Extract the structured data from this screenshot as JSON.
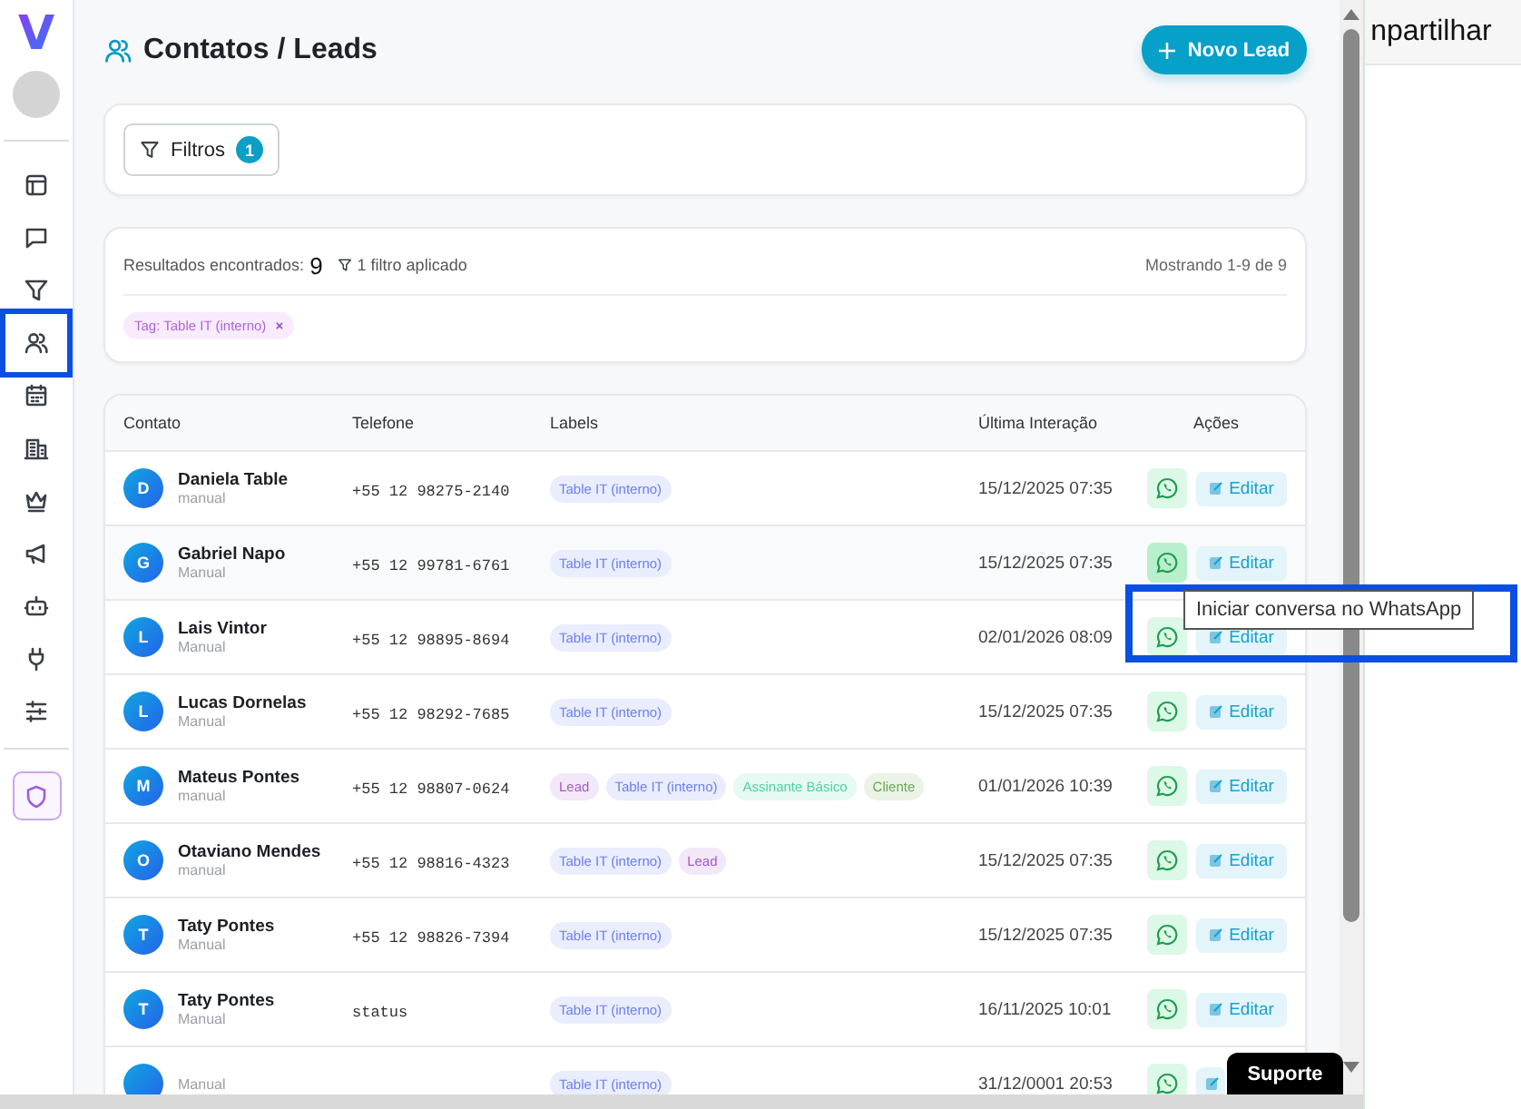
{
  "sidebar": {
    "logo": "V",
    "items": [
      {
        "kind": "layout",
        "selected": false
      },
      {
        "kind": "chat",
        "selected": false
      },
      {
        "kind": "filter",
        "selected": false
      },
      {
        "kind": "users",
        "selected": true
      },
      {
        "kind": "calendar",
        "selected": false
      },
      {
        "kind": "building",
        "selected": false
      },
      {
        "kind": "crown",
        "selected": false
      },
      {
        "kind": "megaphone",
        "selected": false
      },
      {
        "kind": "bot",
        "selected": false
      },
      {
        "kind": "plug",
        "selected": false
      },
      {
        "kind": "sliders",
        "selected": false
      }
    ],
    "bottom_items": [
      {
        "kind": "shield",
        "selected": false
      }
    ]
  },
  "page": {
    "title": "Contatos / Leads",
    "new_button": "Novo Lead"
  },
  "filters": {
    "button": "Filtros",
    "count": "1"
  },
  "results": {
    "label": "Resultados encontrados:",
    "count": "9",
    "applied": "1 filtro aplicado",
    "showing": "Mostrando 1-9 de 9",
    "tags": [
      {
        "text": "Tag: Table IT (interno)",
        "remove": "×"
      }
    ]
  },
  "table": {
    "columns": [
      "Contato",
      "Telefone",
      "Labels",
      "Última Interação",
      "Ações"
    ],
    "rows": [
      {
        "initial": "D",
        "name": "Daniela Table",
        "source": "manual",
        "phone": "+55 12 98275-2140",
        "labels": [
          {
            "text": "Table IT (interno)",
            "color": "#6b7ff0"
          }
        ],
        "last": "15/12/2025 07:35",
        "edit": "Editar",
        "hovered": false
      },
      {
        "initial": "G",
        "name": "Gabriel Napo",
        "source": "Manual",
        "phone": "+55 12 99781-6761",
        "labels": [
          {
            "text": "Table IT (interno)",
            "color": "#6b7ff0"
          }
        ],
        "last": "15/12/2025 07:35",
        "edit": "Editar",
        "hovered": true
      },
      {
        "initial": "L",
        "name": "Lais Vintor",
        "source": "Manual",
        "phone": "+55 12 98895-8694",
        "labels": [
          {
            "text": "Table IT (interno)",
            "color": "#6b7ff0"
          }
        ],
        "last": "02/01/2026 08:09",
        "edit": "Editar",
        "hovered": false
      },
      {
        "initial": "L",
        "name": "Lucas Dornelas",
        "source": "Manual",
        "phone": "+55 12 98292-7685",
        "labels": [
          {
            "text": "Table IT (interno)",
            "color": "#6b7ff0"
          }
        ],
        "last": "15/12/2025 07:35",
        "edit": "Editar",
        "hovered": false
      },
      {
        "initial": "M",
        "name": "Mateus Pontes",
        "source": "manual",
        "phone": "+55 12 98807-0624",
        "labels": [
          {
            "text": "Lead",
            "color": "#a45bc4"
          },
          {
            "text": "Table IT (interno)",
            "color": "#6b7ff0"
          },
          {
            "text": "Assinante Básico",
            "color": "#4fd1a5"
          },
          {
            "text": "Cliente",
            "color": "#6aa84f"
          }
        ],
        "last": "01/01/2026 10:39",
        "edit": "Editar",
        "hovered": false
      },
      {
        "initial": "O",
        "name": "Otaviano Mendes",
        "source": "manual",
        "phone": "+55 12 98816-4323",
        "labels": [
          {
            "text": "Table IT (interno)",
            "color": "#6b7ff0"
          },
          {
            "text": "Lead",
            "color": "#a45bc4"
          }
        ],
        "last": "15/12/2025 07:35",
        "edit": "Editar",
        "hovered": false
      },
      {
        "initial": "T",
        "name": "Taty Pontes",
        "source": "Manual",
        "phone": "+55 12 98826-7394",
        "labels": [
          {
            "text": "Table IT (interno)",
            "color": "#6b7ff0"
          }
        ],
        "last": "15/12/2025 07:35",
        "edit": "Editar",
        "hovered": false
      },
      {
        "initial": "T",
        "name": "Taty Pontes",
        "source": "Manual",
        "phone": "status",
        "labels": [
          {
            "text": "Table IT (interno)",
            "color": "#6b7ff0"
          }
        ],
        "last": "16/11/2025 10:01",
        "edit": "Editar",
        "hovered": false
      },
      {
        "source": "Manual",
        "labels": [
          {
            "text": "Table IT (interno)",
            "color": "#6b7ff0"
          }
        ],
        "last": "31/12/0001 20:53",
        "hovered": false
      }
    ]
  },
  "tooltip": "Iniciar conversa no WhatsApp",
  "support_button": "Suporte",
  "background_window": {
    "text": "npartilhar"
  }
}
